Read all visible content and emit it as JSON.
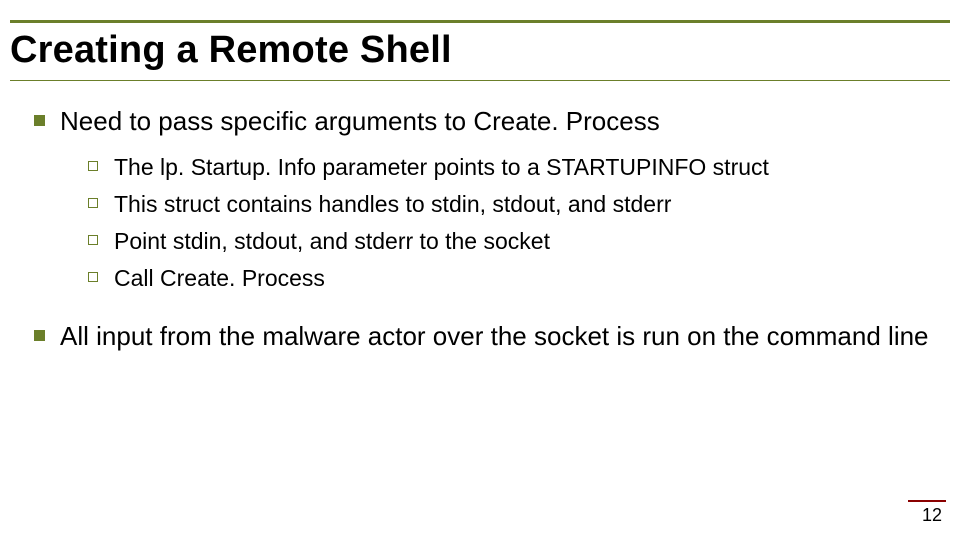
{
  "title": "Creating a Remote Shell",
  "bullets": [
    {
      "text": "Need to pass specific arguments to Create. Process",
      "sub": [
        "The lp. Startup. Info parameter points to a STARTUPINFO struct",
        "This struct contains handles to stdin, stdout, and stderr",
        "Point stdin, stdout, and stderr to the socket",
        "Call Create. Process"
      ]
    },
    {
      "text": "All input from the malware actor over the socket is run on the command line",
      "sub": []
    }
  ],
  "page_number": "12"
}
